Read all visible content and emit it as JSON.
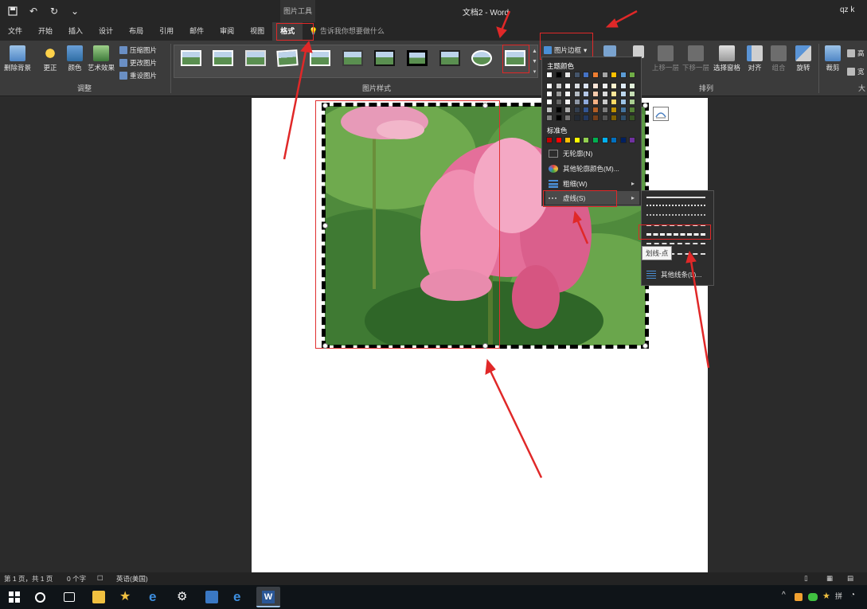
{
  "app": {
    "context_label": "图片工具",
    "doc_title": "文档2 - Word",
    "user": "qz k"
  },
  "tabs": [
    {
      "label": "文件"
    },
    {
      "label": "开始"
    },
    {
      "label": "插入"
    },
    {
      "label": "设计"
    },
    {
      "label": "布局"
    },
    {
      "label": "引用"
    },
    {
      "label": "邮件"
    },
    {
      "label": "审阅"
    },
    {
      "label": "视图"
    },
    {
      "label": "格式"
    }
  ],
  "tellme": "告诉我你想要做什么",
  "ribbon": {
    "remove_bg": "删除背景",
    "corrections": "更正",
    "color": "颜色",
    "artistic": "艺术效果",
    "compress": "压缩图片",
    "change": "更改图片",
    "reset": "重设图片",
    "group_adjust": "调整",
    "group_styles": "图片样式",
    "picture_border": "图片边框",
    "group_arrange": "排列",
    "text_wrap_fragment": "字",
    "bring_forward": "上移一层",
    "send_backward": "下移一层",
    "selection_pane": "选择窗格",
    "align": "对齐",
    "group": "组合",
    "rotate": "旋转",
    "crop": "裁剪",
    "height": "高",
    "width": "宽",
    "group_size_fragment": "大"
  },
  "dropdown": {
    "theme_colors": "主题颜色",
    "standard_colors": "标准色",
    "no_outline": "无轮廓(N)",
    "more_colors": "其他轮廓颜色(M)...",
    "weight": "粗细(W)",
    "dashes": "虚线(S)",
    "standard_swatches": [
      "#c00000",
      "#ff0000",
      "#ffc000",
      "#ffff00",
      "#92d050",
      "#00b050",
      "#00b0f0",
      "#0070c0",
      "#002060",
      "#7030a0"
    ],
    "theme_swatches": [
      "#ffffff",
      "#000000",
      "#e7e6e6",
      "#44546a",
      "#4472c4",
      "#ed7d31",
      "#a5a5a5",
      "#ffc000",
      "#5b9bd5",
      "#70ad47"
    ]
  },
  "submenu": {
    "tooltip": "划线-点",
    "more_lines": "其他线条(L)..."
  },
  "status": {
    "page": "第 1 页，共 1 页",
    "words": "0 个字",
    "language": "英语(美国)"
  },
  "colors": {
    "accent_red": "#e02828",
    "ribbon_bg": "#3b3b3b",
    "title_bg": "#262626"
  }
}
